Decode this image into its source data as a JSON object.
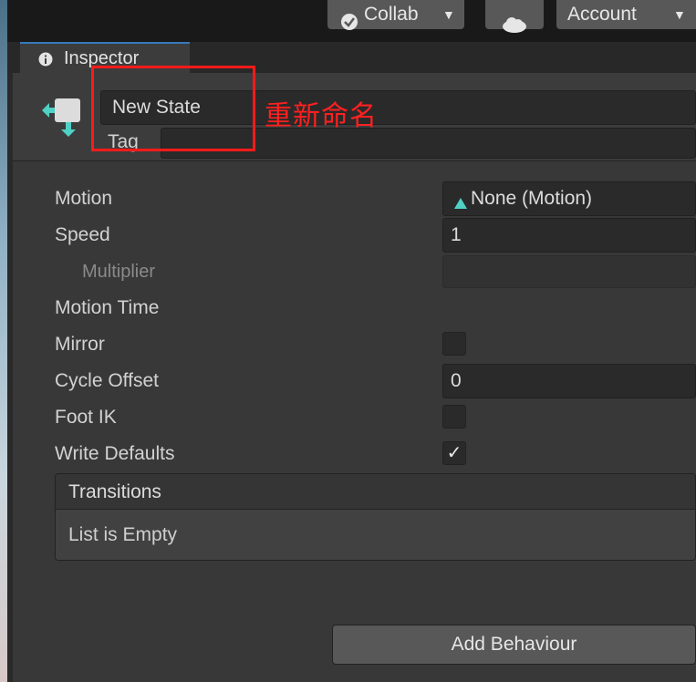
{
  "toolbar": {
    "collab_label": "Collab",
    "account_label": "Account"
  },
  "tab": {
    "label": "Inspector"
  },
  "header": {
    "name_value": "New State",
    "tag_label": "Tag",
    "tag_value": ""
  },
  "properties": {
    "motion_label": "Motion",
    "motion_value": "None (Motion)",
    "speed_label": "Speed",
    "speed_value": "1",
    "multiplier_label": "Multiplier",
    "motion_time_label": "Motion Time",
    "mirror_label": "Mirror",
    "mirror_checked": false,
    "cycle_offset_label": "Cycle Offset",
    "cycle_offset_value": "0",
    "foot_ik_label": "Foot IK",
    "foot_ik_checked": false,
    "write_defaults_label": "Write Defaults",
    "write_defaults_checked": true,
    "checkmark_glyph": "✓"
  },
  "transitions": {
    "header": "Transitions",
    "empty_text": "List is Empty"
  },
  "add_behaviour_label": "Add Behaviour",
  "annotation": {
    "text": "重新命名",
    "color": "#ff1a1a"
  },
  "colors": {
    "panel": "#383838",
    "field": "#2a2a2a",
    "tab_accent": "#3a79bb",
    "motion_icon": "#4fd1c5"
  }
}
